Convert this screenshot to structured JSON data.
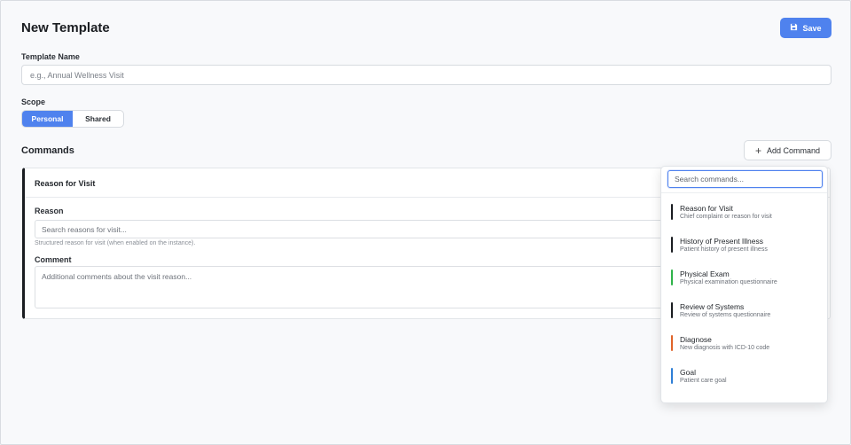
{
  "header": {
    "title": "New Template",
    "save_label": "Save"
  },
  "template_name": {
    "label": "Template Name",
    "placeholder": "e.g., Annual Wellness Visit"
  },
  "scope": {
    "label": "Scope",
    "options": [
      "Personal",
      "Shared"
    ],
    "selected": "Personal"
  },
  "commands": {
    "title": "Commands",
    "add_label": "Add Command",
    "card": {
      "title": "Reason for Visit",
      "reason_label": "Reason",
      "reason_placeholder": "Search reasons for visit...",
      "reason_helper": "Structured reason for visit (when enabled on the instance).",
      "comment_label": "Comment",
      "comment_placeholder": "Additional comments about the visit reason..."
    }
  },
  "dropdown": {
    "search_placeholder": "Search commands...",
    "items": [
      {
        "name": "Reason for Visit",
        "desc": "Chief complaint or reason for visit",
        "color": "#1a1d21"
      },
      {
        "name": "History of Present Illness",
        "desc": "Patient history of present illness",
        "color": "#1a1d21"
      },
      {
        "name": "Physical Exam",
        "desc": "Physical examination questionnaire",
        "color": "#2fb34a"
      },
      {
        "name": "Review of Systems",
        "desc": "Review of systems questionnaire",
        "color": "#1a1d21"
      },
      {
        "name": "Diagnose",
        "desc": "New diagnosis with ICD-10 code",
        "color": "#e0642a"
      },
      {
        "name": "Goal",
        "desc": "Patient care goal",
        "color": "#2f7fd6"
      }
    ]
  },
  "colors": {
    "accent": "#4f82ee"
  },
  "icons": {
    "save": "save-icon",
    "add": "plus-icon"
  }
}
